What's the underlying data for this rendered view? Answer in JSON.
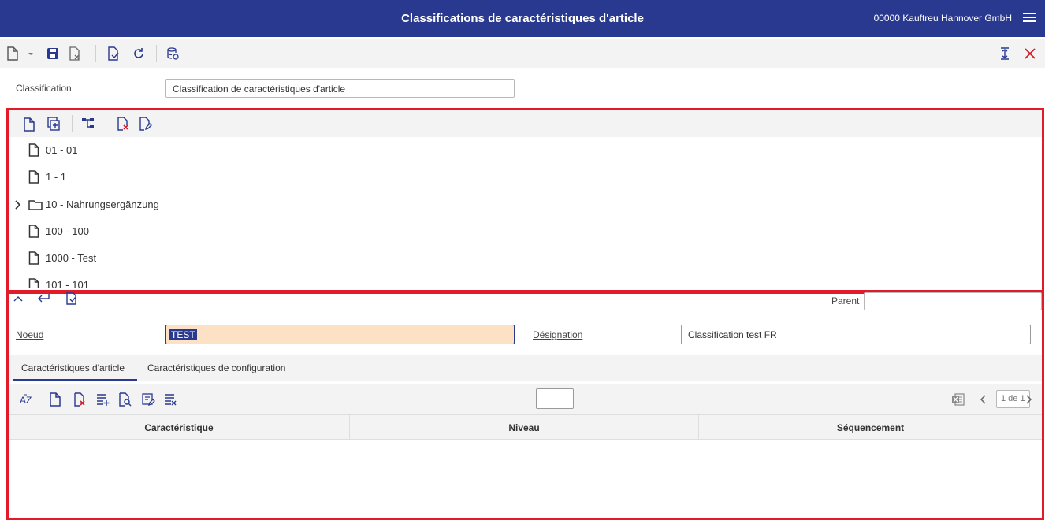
{
  "header": {
    "title": "Classifications de caractéristiques d'article",
    "company": "00000  Kauftreu Hannover GmbH"
  },
  "classification": {
    "label": "Classification",
    "value": "Classification de caractéristiques d'article"
  },
  "tree": {
    "items": [
      {
        "label": "01 - 01",
        "type": "file"
      },
      {
        "label": "1 - 1",
        "type": "file"
      },
      {
        "label": "10 - Nahrungsergänzung",
        "type": "folder",
        "expandable": true
      },
      {
        "label": "100 - 100",
        "type": "file"
      },
      {
        "label": "1000 - Test",
        "type": "file"
      },
      {
        "label": "101 - 101",
        "type": "file"
      }
    ]
  },
  "detail": {
    "parent_label": "Parent",
    "parent_value": "",
    "node_label": "Noeud",
    "node_value": "TEST",
    "designation_label": "Désignation",
    "designation_value": "Classification test FR"
  },
  "tabs": [
    {
      "label": "Caractéristiques d'article",
      "active": true
    },
    {
      "label": "Caractéristiques de configuration",
      "active": false
    }
  ],
  "grid": {
    "quick_input": "",
    "pager": "1 de 1",
    "columns": [
      "Caractéristique",
      "Niveau",
      "Séquencement"
    ]
  },
  "colors": {
    "header_bg": "#2a3990",
    "accent": "#2a3990",
    "highlight_box": "#e11b2a",
    "node_field_bg": "#fde1c5",
    "close": "#d11c2a"
  },
  "icons": {
    "main_toolbar": [
      "new-document-icon",
      "dropdown-arrow-icon",
      "save-icon",
      "discard-icon",
      "document-check-icon",
      "refresh-icon",
      "database-icon",
      "text-cursor-icon",
      "close-icon"
    ],
    "tree_toolbar": [
      "new-node-icon",
      "copy-node-icon",
      "hierarchy-icon",
      "delete-node-icon",
      "edit-node-icon"
    ],
    "detail_toolbar": [
      "collapse-up-icon",
      "back-icon",
      "document-check-icon"
    ],
    "grid_toolbar": [
      "sort-az-icon",
      "new-row-icon",
      "delete-row-icon",
      "add-lines-icon",
      "search-row-icon",
      "edit-list-icon",
      "clear-list-icon",
      "excel-icon",
      "prev-page-icon",
      "next-page-icon"
    ]
  }
}
